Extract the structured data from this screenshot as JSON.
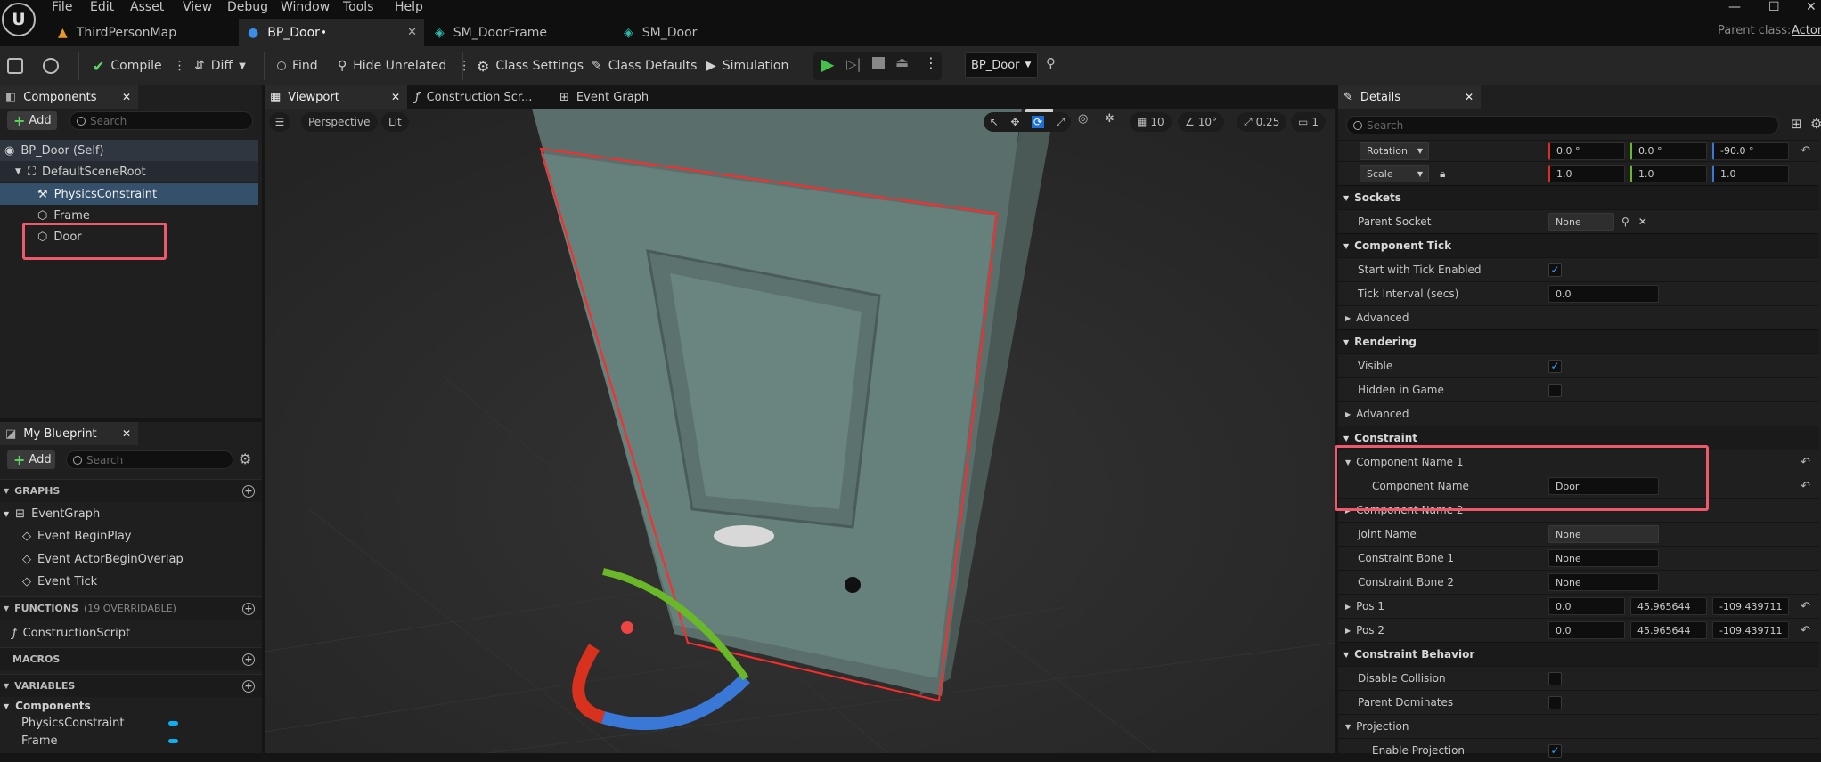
{
  "window": {
    "menu": [
      "File",
      "Edit",
      "Asset",
      "View",
      "Debug",
      "Window",
      "Tools",
      "Help"
    ],
    "tabs": [
      "ThirdPersonMap",
      "BP_Door•",
      "SM_DoorFrame",
      "SM_Door"
    ],
    "parent_class_label": "Parent class:",
    "parent_class_value": "Actor"
  },
  "toolbar": {
    "compile": "Compile",
    "diff": "Diff",
    "find": "Find",
    "hide_unrelated": "Hide Unrelated",
    "class_settings": "Class Settings",
    "class_defaults": "Class Defaults",
    "simulation": "Simulation",
    "debug_object": "BP_Door"
  },
  "components": {
    "tab": "Components",
    "add": "Add",
    "search_placeholder": "Search",
    "tree": [
      "BP_Door (Self)",
      "DefaultSceneRoot",
      "PhysicsConstraint",
      "Frame",
      "Door"
    ]
  },
  "my_blueprint": {
    "tab": "My Blueprint",
    "add": "Add",
    "search_placeholder": "Search",
    "graphs_header": "GRAPHS",
    "graphs": [
      "EventGraph",
      "Event BeginPlay",
      "Event ActorBeginOverlap",
      "Event Tick"
    ],
    "functions_header": "FUNCTIONS",
    "functions_count": "(19 OVERRIDABLE)",
    "functions": [
      "ConstructionScript"
    ],
    "macros_header": "MACROS",
    "variables_header": "VARIABLES",
    "variables_category": "Components",
    "variables": [
      "PhysicsConstraint",
      "Frame"
    ]
  },
  "center_tabs": [
    "Viewport",
    "Construction Scr...",
    "Event Graph"
  ],
  "viewport": {
    "perspective": "Perspective",
    "lit": "Lit",
    "grid": "10",
    "angle": "10°",
    "scale": "0.25",
    "camera": "1"
  },
  "details": {
    "tab": "Details",
    "search_placeholder": "Search",
    "rotation": {
      "label": "Rotation",
      "x": "0.0 °",
      "y": "0.0 °",
      "z": "-90.0 °"
    },
    "scale": {
      "label": "Scale",
      "x": "1.0",
      "y": "1.0",
      "z": "1.0"
    },
    "sockets": "Sockets",
    "parent_socket": "Parent Socket",
    "parent_socket_value": "None",
    "component_tick": "Component Tick",
    "start_tick": "Start with Tick Enabled",
    "tick_interval": "Tick Interval (secs)",
    "tick_interval_value": "0.0",
    "advanced": "Advanced",
    "rendering": "Rendering",
    "visible": "Visible",
    "hidden_in_game": "Hidden in Game",
    "advanced2": "Advanced",
    "constraint": "Constraint",
    "component_name_1": "Component Name 1",
    "component_name": "Component Name",
    "component_name_value": "Door",
    "component_name_2": "Component Name 2",
    "joint_name": "Joint Name",
    "joint_name_value": "None",
    "bone1": "Constraint Bone 1",
    "bone1_value": "None",
    "bone2": "Constraint Bone 2",
    "bone2_value": "None",
    "pos1": "Pos 1",
    "pos1_x": "0.0",
    "pos1_y": "45.965644",
    "pos1_z": "-109.439711",
    "pos2": "Pos 2",
    "pos2_x": "0.0",
    "pos2_y": "45.965644",
    "pos2_z": "-109.439711",
    "constraint_behavior": "Constraint Behavior",
    "disable_collision": "Disable Collision",
    "parent_dominates": "Parent Dominates",
    "projection": "Projection",
    "enable_projection": "Enable Projection"
  },
  "colors": {
    "highlight": "#ee5a6b",
    "accent": "#3aa0ff",
    "play": "#45c04a"
  }
}
